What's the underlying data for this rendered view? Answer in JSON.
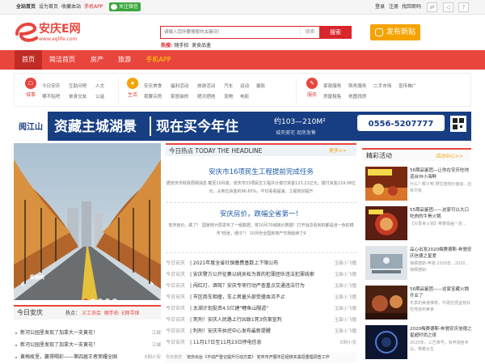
{
  "topbar": {
    "links": [
      "全站首页",
      "设为首页",
      "收藏本站",
      "手机APP"
    ],
    "wechat": "关注微信",
    "right_links": [
      "登录",
      "注册",
      "找回密码"
    ],
    "icons": [
      "shuffle-icon",
      "share-icon",
      "help-icon"
    ]
  },
  "logo": {
    "name": "安庆E网",
    "url": "www.aqlife.com"
  },
  "search": {
    "placeholder": "请输入您所要搜索的关键词！",
    "inner_button": "搜索",
    "button": "搜索",
    "hot_label": "热搜:",
    "hot_words": [
      "随手拍",
      "美食品鉴"
    ]
  },
  "publish_button": "发布新贴",
  "nav": [
    "首页",
    "简洁首页",
    "房产",
    "旅游",
    "手机APP"
  ],
  "categories": [
    {
      "label": "城事",
      "icon": "city-icon",
      "color": "#e8463d",
      "links": [
        [
          "今日安庆",
          "互助问吧",
          "人文"
        ],
        [
          "哪不贴吧",
          "单身交友",
          "公益"
        ]
      ]
    },
    {
      "label": "生活",
      "icon": "star-icon",
      "color": "#f5a300",
      "links": [
        [
          "安庆美食",
          "福利活动",
          "旅游活动",
          "汽车",
          "运动",
          "摄影"
        ],
        [
          "我要买房",
          "家居装修",
          "晒天晒地",
          "宠物",
          "电影"
        ]
      ]
    },
    {
      "label": "服务",
      "icon": "service-icon",
      "color": "#e8463d",
      "links": [
        [
          "家政服务",
          "殡务服务",
          "二手市场",
          "宣传推广"
        ],
        [
          "房屋租售",
          "地图找房"
        ]
      ]
    }
  ],
  "banner": {
    "brand": "阅江山",
    "slogan": "资藏主城湖景",
    "slogan2": "现在买今年住",
    "area": "约103—210M²",
    "phone": "0556-5207777",
    "address": "城央美宅 现房发售"
  },
  "slideshow": {
    "caption": "梧桐树",
    "dots": 5,
    "active_dot": 1
  },
  "headline": {
    "title": "今日热点 TODAY THE HEADLINE",
    "more": "更多>>",
    "items": [
      {
        "title": "安庆市16项民生工程提前完成任务",
        "desc": "据安庆市财政局网消息 截至10月底，安庆市33项民生工程共计拨付资金123.21亿元，拨付资金119.08亿元，占到位资金的96.65%。平均看看提速，工程地训提升"
      },
      {
        "title": "安庆房价，跌幅全省第一！",
        "desc": "安庆房价，跌了！ 国家统计局发布了一组数据，将10月70城房价数据！打开消息看到的都是该一色的楼市\"低迷，通冷\"！ 10月份全国房地产市场延续了9"
      }
    ]
  },
  "news": [
    {
      "cat": "今日安庆",
      "title": "| 2021年度全省社保缴费基数上下限公布",
      "src": "玉面小飞猪"
    },
    {
      "cat": "今日安庆",
      "title": "| 安庆警方公开征集以姚吴松为首的犯罪团伙违法犯罪线索",
      "src": "玉面小飞猪"
    },
    {
      "cat": "今日安庆",
      "title": "| 闯红灯、酒驾？安庆专项行动严查重点交通违法行为",
      "src": "玉面小飞猪"
    },
    {
      "cat": "今日安庆",
      "title": "| 市区商车相撞，车上男童头部受撞血流不止",
      "src": "玉面小飞猪"
    },
    {
      "cat": "今日安庆",
      "title": "| 太湖计划投资4.5亿建\"鲤鱼山隧道\"",
      "src": "玉面小飞猪"
    },
    {
      "cat": "今日安庆",
      "title": "| 死刑！安庆人民路上行凶致1死3伤案宣判",
      "src": "玉面小飞猪"
    },
    {
      "cat": "今日安庆",
      "title": "| 判刑！安庆市执控中心发布最新提醒",
      "src": "玉面小飞猪"
    },
    {
      "cat": "今日安庆",
      "title": "| 11月17日至11月23日停电信息",
      "src": "E网小安"
    },
    {
      "cat": "今日安庆",
      "title": "安庆出台《不动产登记提升行动方案》    安庆市开展市区经核实黑招重理调查工作",
      "src": ""
    }
  ],
  "featured": {
    "title": "精彩活动",
    "more": "活动中心>>",
    "items": [
      {
        "title": "56期品鉴团—让你在安庆吃地道台州小海鲜",
        "desc": "什么？椰子鸭 野生植物炒面饭...应有尽有",
        "colors": [
          "#7a2a10",
          "#d9762b"
        ]
      },
      {
        "title": "55期品鉴团——这家可以大口吃肉的牛骨火锅",
        "desc": "【大黍来火锅】带着锅盖一定...",
        "colors": [
          "#5a1e12",
          "#c43a25"
        ]
      },
      {
        "title": "品心出发2020梅赛德斯-奔驰安庆信德之星爱",
        "desc": "梅赛德斯-奔驰 2020年...2020...梅赛德斯-",
        "colors": [
          "#9aa9b4",
          "#e4e7ea"
        ]
      },
      {
        "title": "56期品鉴团——这家宝藏火锅开业了",
        "desc": "冬季的美食推荐，牛硬还便宜有好吃地道的美食",
        "colors": [
          "#4a2010",
          "#b0552e"
        ]
      },
      {
        "title": "2020梅赛德斯-奔驰安庆信德之星超时尚之夜",
        "desc": "2020年，三巴奉号，有奔驰各专业，带着女生",
        "colors": [
          "#0d1530",
          "#1f3a6e"
        ]
      }
    ]
  },
  "today_box": {
    "title": "今日安庆",
    "kw_label": "热点：",
    "keywords": [
      "义工协会",
      "随手拍",
      "E网寻保"
    ],
    "items": [
      {
        "title": "新河公园里发现了加拿大一支黄花！",
        "src": "江城"
      },
      {
        "title": "新河公园里发现了加拿大一支黄花！",
        "src": "江城"
      },
      {
        "title": "黄梅故里，赢得喝彩——第四届王者荣耀全国",
        "src": "E网小安"
      }
    ]
  }
}
